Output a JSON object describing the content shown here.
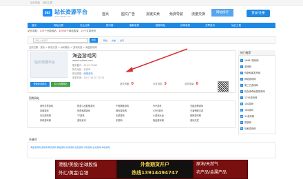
{
  "topbar": {
    "left_links": [
      "站长导航",
      "站长工具"
    ]
  },
  "header": {
    "logo_mark": "365",
    "logo_text": "站长资源平台",
    "logo_sub": "www.365zz.com",
    "nav": [
      "首页",
      "图文广告",
      "友链买卖",
      "免费导航",
      "流量交换"
    ],
    "nav_active": "网站排行",
    "login": "登录/注册"
  },
  "subnav": [
    "首页",
    "网站分类",
    "行业分类",
    "排行榜",
    "最新收录",
    "推荐网站",
    "快审收录",
    "文章资讯",
    "站长工具"
  ],
  "stats": {
    "prefix": "站长导航：",
    "count1": "133",
    "mid1": "个分类网站，",
    "count2": "40958",
    "mid2": "个网站收录，",
    "count3": "25",
    "suffix": "个文章资讯"
  },
  "search": {
    "placeholder": "请输入关键词",
    "button": "搜索",
    "cats": [
      "网站",
      "文章",
      "资讯"
    ]
  },
  "breadcrumb": "当前位置：首页 > 网站分类 > 休闲娱乐 > 游戏动漫 > 海盗游戏网",
  "site": {
    "thumb_text": "站长资源平台",
    "title": "海盗游戏网",
    "url": "www.haidao.com",
    "ip_label": "服务器IP：",
    "ip": "47.92.79.65",
    "loc_label": "所在地区：",
    "loc": "北京市",
    "cat_label": "网站类型：",
    "cat": "网络游戏",
    "date_label": "收录时间：",
    "date": "2017-10-07 22:15",
    "btn1": "快速收录网站",
    "btn2": "加入收藏网站",
    "m1_label": "站长热度：",
    "m1": "0",
    "m2_label": "今日浏览：",
    "m2": "5",
    "m3_label": "总浏览量：",
    "m3": "0"
  },
  "hot": {
    "title": "热门推荐",
    "items": [
      "16987游戏网",
      "游戏网",
      "传奇私服发布网",
      "网络游戏网",
      "第三方游戏网",
      "热血传奇私服发布网",
      "1259游戏网",
      "100游戏",
      "180游戏",
      "91游戏网",
      "易游网",
      "玩家游戏网"
    ]
  },
  "related": {
    "title": "同类网站",
    "items": [
      "创世灵界游戏",
      "西游斗战胜佛游戏",
      "千炮捕鱼游戏",
      "PVP游戏",
      "无敌战神游戏",
      "百度游戏",
      "传奇私服游戏",
      "网页游戏网",
      "4399游戏",
      "王者荣耀手游",
      "天天游戏网",
      "37游戏",
      "乐游游戏",
      "小游戏大全",
      "官网游戏网",
      "传奇游戏网",
      "游戏资讯",
      "手游网",
      "极品游戏网",
      "游戏天堂"
    ]
  },
  "keywords": {
    "title": "关键词",
    "text": "海盗游戏网,游戏网,网页游戏,网络游戏,休闲游戏,免费游戏,手机游戏,在线游戏,单机游戏"
  },
  "banner": {
    "left1": "港股/美股/全球股指",
    "left2": "外汇/黄金/白银",
    "mid1": "外盘期货开户",
    "mid2": "热线13914494747",
    "right1": "原油/天然气",
    "right2": "农产品/金属产品"
  }
}
